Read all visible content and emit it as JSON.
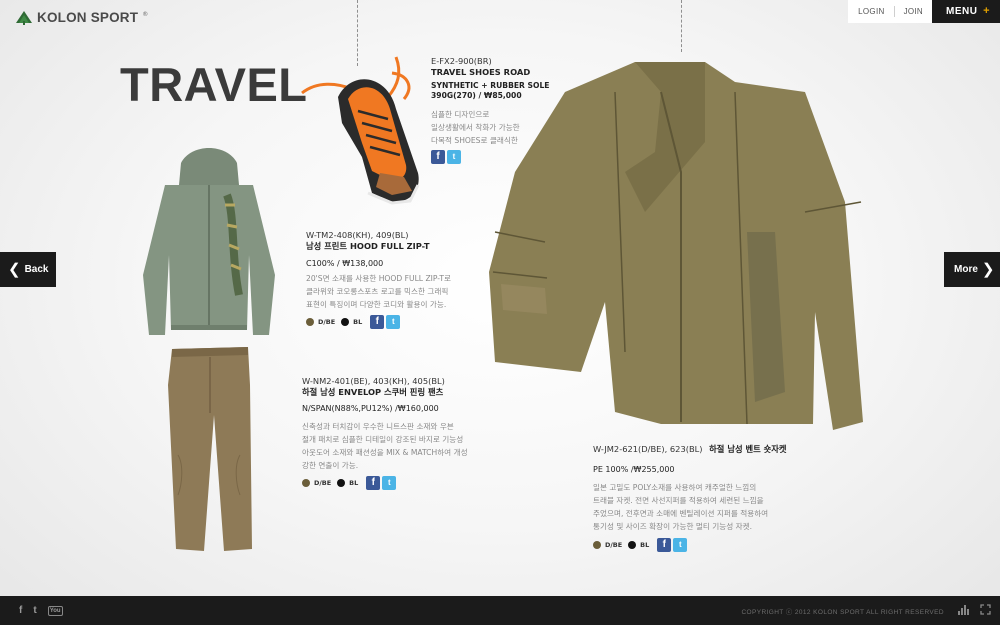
{
  "brand": {
    "name": "KOLON SPORT",
    "trademark": "®",
    "accent": "#e0a000"
  },
  "topnav": {
    "login": "LOGIN",
    "join": "JOIN",
    "menu": "MENU",
    "menu_plus": "+"
  },
  "title": "TRAVEL",
  "nav": {
    "back": "Back",
    "more": "More"
  },
  "products": {
    "shoes": {
      "code": "E-FX2-900(BR)",
      "name": "TRAVEL SHOES ROAD",
      "spec_line1": "SYNTHETIC + RUBBER SOLE",
      "spec_line2": "390G(270) / ₩85,000",
      "desc_line1": "심플한 디자인으로",
      "desc_line2": "일상생활에서 착화가 가능한",
      "desc_line3": "다목적 SHOES로 클래식한"
    },
    "hoodie": {
      "code": "W-TM2-408(KH), 409(BL)",
      "name": "남성 프린트 HOOD FULL ZIP-T",
      "price": "C100% / ₩138,000",
      "desc_line1": "20'S면 소재를 사용한 HOOD FULL ZIP-T로",
      "desc_line2": "클라위와 코오롱스포츠 로고를 믹스한 그래픽",
      "desc_line3": "표현이 특징이며 다양한 코디와 활용이 가능.",
      "colors": [
        {
          "label": "D/BE",
          "hex": "#6b5e3a"
        },
        {
          "label": "BL",
          "hex": "#111111"
        }
      ]
    },
    "pants": {
      "code": "W-NM2-401(BE), 403(KH), 405(BL)",
      "name": "하절 남성 ENVELOP 스쿠버 핀링 팬츠",
      "price": "N/SPAN(N88%,PU12%) /₩160,000",
      "desc_line1": "신축성과 터치감이 우수한 니트스판 소재와 우븐",
      "desc_line2": "절개 패치로 심플한 디테일이 강조된 바지로 기능성",
      "desc_line3": "아웃도어 소재와 패션성을 MIX & MATCH하여 개성",
      "desc_line4": "강한 연출이 가능.",
      "colors": [
        {
          "label": "D/BE",
          "hex": "#6b5e3a"
        },
        {
          "label": "BL",
          "hex": "#111111"
        }
      ]
    },
    "jacket": {
      "code": "W-JM2-621(D/BE), 623(BL)",
      "name": "하절 남성 벤트 숏자켓",
      "price": "PE 100% /₩255,000",
      "desc_line1": "일본 고밀도 POLY소재를 사용하여 캐주얼한 느낌의",
      "desc_line2": "트래블 자켓. 전면 사선지퍼를 적용하여 세련된 느낌을",
      "desc_line3": "주었으며, 전후면과 소매에 벤틸레이션 지퍼를 적용하여",
      "desc_line4": "통기성 및 사이즈 확장이 가능한 멀티 기능성 자켓.",
      "colors": [
        {
          "label": "D/BE",
          "hex": "#6b5e3a"
        },
        {
          "label": "BL",
          "hex": "#111111"
        }
      ]
    }
  },
  "share": {
    "facebook": "f",
    "twitter": "t"
  },
  "footer": {
    "copyright": "COPYRIGHT ⓒ 2012 KOLON SPORT ALL RIGHT RESERVED",
    "facebook": "f",
    "twitter": "t",
    "youtube": "You"
  }
}
